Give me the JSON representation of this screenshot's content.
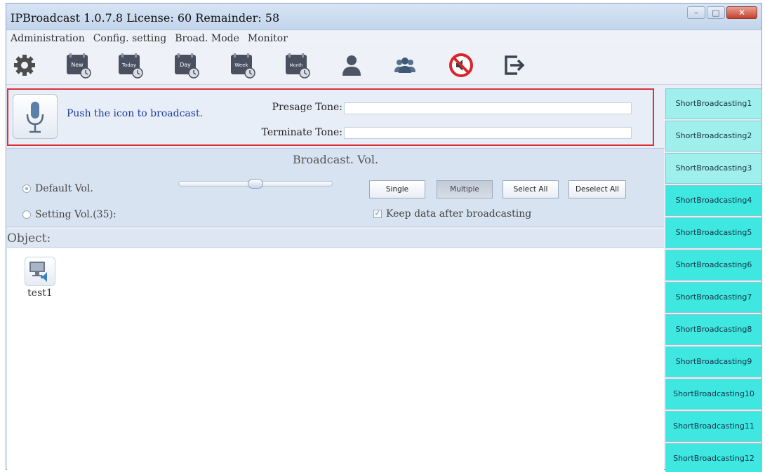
{
  "window": {
    "title": "IPBroadcast 1.0.7.8 License: 60 Remainder: 58",
    "controls": {
      "minimize": "–",
      "maximize": "□",
      "close": "✕"
    }
  },
  "menu": [
    "Administration",
    "Config. setting",
    "Broad. Mode",
    "Monitor"
  ],
  "toolbar": {
    "icons": [
      "gear-icon",
      "new-calendar-icon",
      "today-calendar-icon",
      "day-calendar-icon",
      "week-calendar-icon",
      "month-calendar-icon",
      "user-icon",
      "group-icon",
      "mute-icon",
      "exit-icon"
    ],
    "calendar_labels": {
      "new": "New",
      "today": "Today",
      "day": "Day",
      "week": "Week",
      "month": "Month"
    }
  },
  "broadcast": {
    "push_text": "Push the icon to broadcast.",
    "presage_label": "Presage Tone:",
    "presage_value": "",
    "terminate_label": "Terminate Tone:",
    "terminate_value": ""
  },
  "volume": {
    "title": "Broadcast. Vol.",
    "default_label": "Default Vol.",
    "setting_label": "Setting Vol.(35):",
    "selected": "default",
    "slider_level": 0.5,
    "buttons": {
      "single": "Single",
      "multiple": "Multiple",
      "select_all": "Select All",
      "deselect_all": "Deselect All"
    },
    "pressed_button": "multiple",
    "keep_data_label": "Keep data after broadcasting",
    "keep_data_checked": true
  },
  "objects": {
    "header": "Object:",
    "items": [
      {
        "name": "test1"
      }
    ]
  },
  "short_broadcasting": [
    "ShortBroadcasting1",
    "ShortBroadcasting2",
    "ShortBroadcasting3",
    "ShortBroadcasting4",
    "ShortBroadcasting5",
    "ShortBroadcasting6",
    "ShortBroadcasting7",
    "ShortBroadcasting8",
    "ShortBroadcasting9",
    "ShortBroadcasting10",
    "ShortBroadcasting11",
    "ShortBroadcasting12"
  ],
  "colors": {
    "accent_border": "#d9323a",
    "short_button": "#3ee8e0",
    "push_text": "#1c3c9c"
  }
}
